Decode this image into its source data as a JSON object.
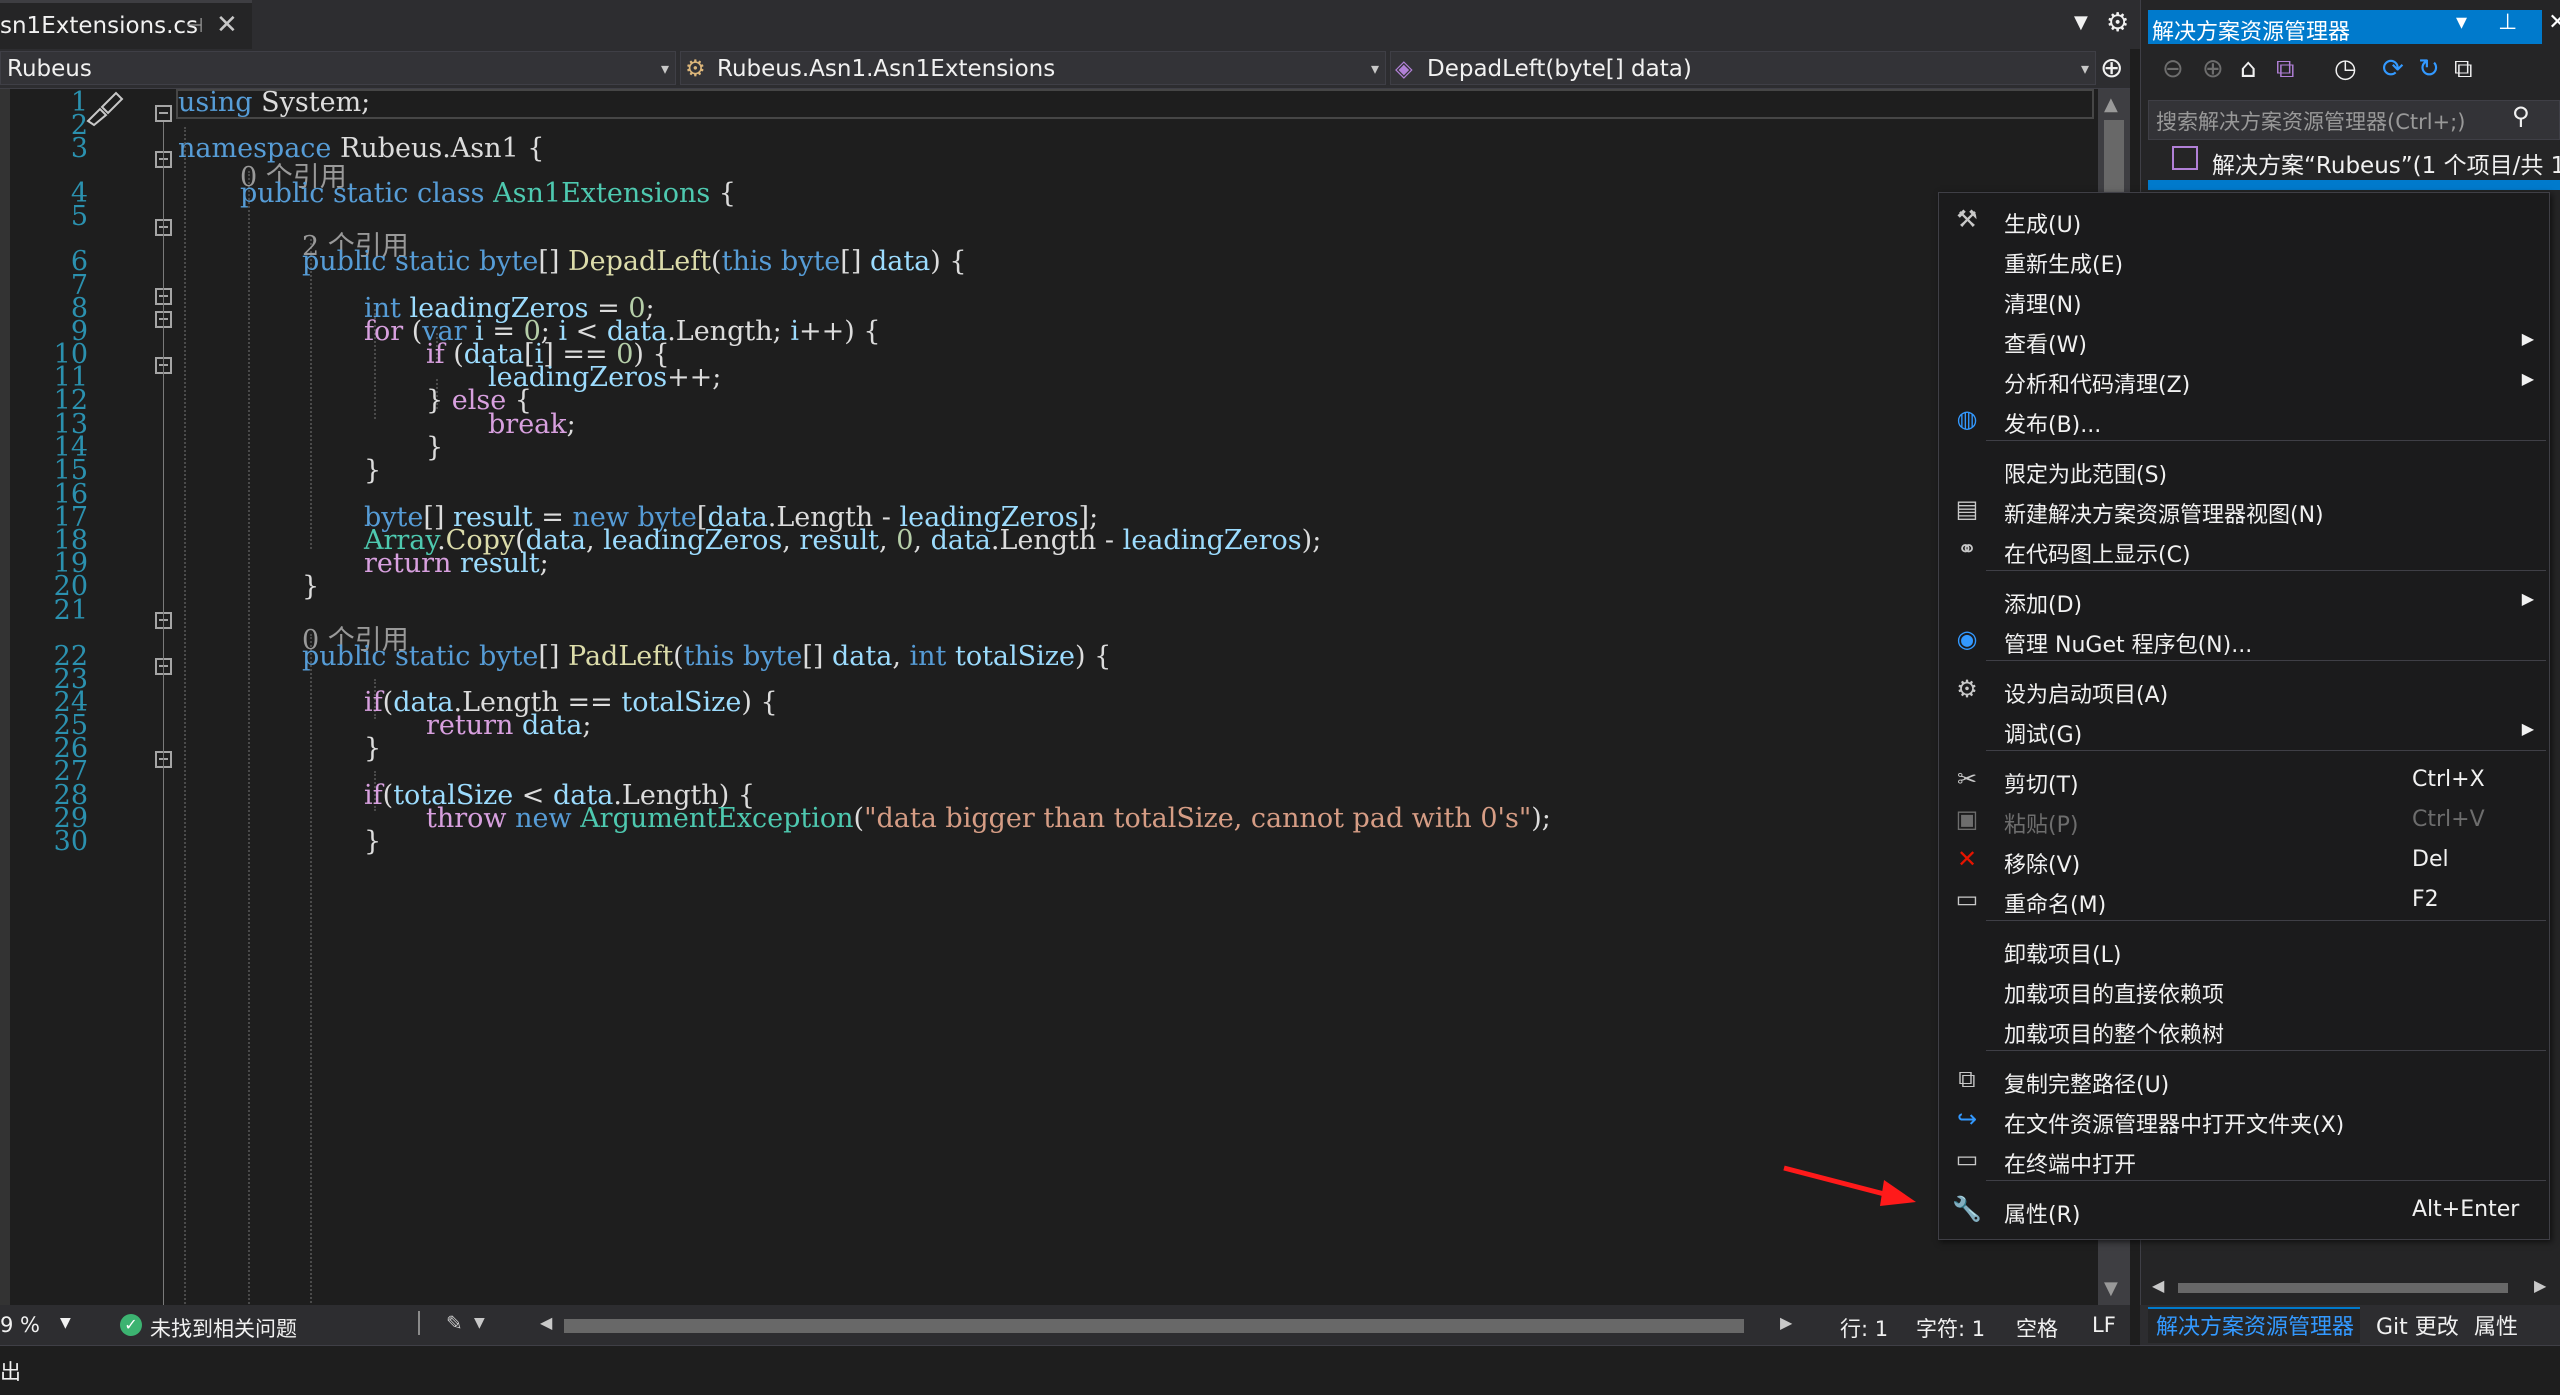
{
  "doc_tab": {
    "title": "sn1Extensions.cs",
    "pin_icon": "pin-icon",
    "close": "✕"
  },
  "tab_controls": {
    "overflow": "▼",
    "settings": "⚙"
  },
  "nav": {
    "project": "Rubeus",
    "class": "Rubeus.Asn1.Asn1Extensions",
    "member": "DepadLeft(byte[] data)"
  },
  "colors": {
    "keyword": "#569cd6",
    "type": "#4ec9b0",
    "method": "#dcdcaa",
    "parameter": "#9cdcfe",
    "string": "#d69d85",
    "number": "#b5cea8",
    "control": "#d8a0df",
    "line_number": "#2b91af",
    "accent": "#007acc",
    "annotation_arrow": "#ff1a1a"
  },
  "code": {
    "line_numbers": [
      "1",
      "2",
      "3",
      "4",
      "5",
      "6",
      "7",
      "8",
      "9",
      "10",
      "11",
      "12",
      "13",
      "14",
      "15",
      "16",
      "17",
      "18",
      "19",
      "20",
      "21",
      "22",
      "23",
      "24",
      "25",
      "26",
      "27",
      "28",
      "29",
      "30"
    ],
    "refs": {
      "class_refs": "0 个引用",
      "depad_refs": "2 个引用",
      "pad_refs": "0 个引用"
    }
  },
  "status": {
    "zoom": "9 %",
    "issues": "未找到相关问题",
    "line": "行: 1",
    "char": "字符: 1",
    "whitespace": "空格",
    "line_ending": "LF"
  },
  "solution_explorer": {
    "title": "解决方案资源管理器",
    "title_buttons": "▾ ⊥ ✕",
    "search_placeholder": "搜索解决方案资源管理器(Ctrl+;)",
    "solution_node": "解决方案“Rubeus”(1 个项目/共 1",
    "tabs": {
      "active": "解决方案资源管理器",
      "git": "Git 更改",
      "properties": "属性"
    }
  },
  "context_menu": {
    "items": [
      {
        "label": "生成(U)",
        "icon": "build-icon",
        "shortcut": "",
        "submenu": false,
        "enabled": true
      },
      {
        "label": "重新生成(E)",
        "icon": "",
        "shortcut": "",
        "submenu": false,
        "enabled": true
      },
      {
        "label": "清理(N)",
        "icon": "",
        "shortcut": "",
        "submenu": false,
        "enabled": true
      },
      {
        "label": "查看(W)",
        "icon": "",
        "shortcut": "",
        "submenu": true,
        "enabled": true
      },
      {
        "label": "分析和代码清理(Z)",
        "icon": "",
        "shortcut": "",
        "submenu": true,
        "enabled": true
      },
      {
        "label": "发布(B)...",
        "icon": "globe-icon",
        "shortcut": "",
        "submenu": false,
        "enabled": true
      },
      {
        "label": "限定为此范围(S)",
        "icon": "",
        "shortcut": "",
        "submenu": false,
        "enabled": true
      },
      {
        "label": "新建解决方案资源管理器视图(N)",
        "icon": "new-view-icon",
        "shortcut": "",
        "submenu": false,
        "enabled": true
      },
      {
        "label": "在代码图上显示(C)",
        "icon": "code-map-icon",
        "shortcut": "",
        "submenu": false,
        "enabled": true
      },
      {
        "label": "添加(D)",
        "icon": "",
        "shortcut": "",
        "submenu": true,
        "enabled": true
      },
      {
        "label": "管理 NuGet 程序包(N)...",
        "icon": "nuget-icon",
        "shortcut": "",
        "submenu": false,
        "enabled": true
      },
      {
        "label": "设为启动项目(A)",
        "icon": "gear-icon",
        "shortcut": "",
        "submenu": false,
        "enabled": true
      },
      {
        "label": "调试(G)",
        "icon": "",
        "shortcut": "",
        "submenu": true,
        "enabled": true
      },
      {
        "label": "剪切(T)",
        "icon": "cut-icon",
        "shortcut": "Ctrl+X",
        "submenu": false,
        "enabled": true
      },
      {
        "label": "粘贴(P)",
        "icon": "paste-icon",
        "shortcut": "Ctrl+V",
        "submenu": false,
        "enabled": false
      },
      {
        "label": "移除(V)",
        "icon": "remove-icon",
        "shortcut": "Del",
        "submenu": false,
        "enabled": true
      },
      {
        "label": "重命名(M)",
        "icon": "rename-icon",
        "shortcut": "F2",
        "submenu": false,
        "enabled": true
      },
      {
        "label": "卸载项目(L)",
        "icon": "",
        "shortcut": "",
        "submenu": false,
        "enabled": true
      },
      {
        "label": "加载项目的直接依赖项",
        "icon": "",
        "shortcut": "",
        "submenu": false,
        "enabled": true
      },
      {
        "label": "加载项目的整个依赖树",
        "icon": "",
        "shortcut": "",
        "submenu": false,
        "enabled": true
      },
      {
        "label": "复制完整路径(U)",
        "icon": "copy-path-icon",
        "shortcut": "",
        "submenu": false,
        "enabled": true
      },
      {
        "label": "在文件资源管理器中打开文件夹(X)",
        "icon": "open-folder-icon",
        "shortcut": "",
        "submenu": false,
        "enabled": true
      },
      {
        "label": "在终端中打开",
        "icon": "terminal-icon",
        "shortcut": "",
        "submenu": false,
        "enabled": true
      },
      {
        "label": "属性(R)",
        "icon": "wrench-icon",
        "shortcut": "Alt+Enter",
        "submenu": false,
        "enabled": true
      }
    ]
  },
  "bottom": {
    "output": "出"
  }
}
